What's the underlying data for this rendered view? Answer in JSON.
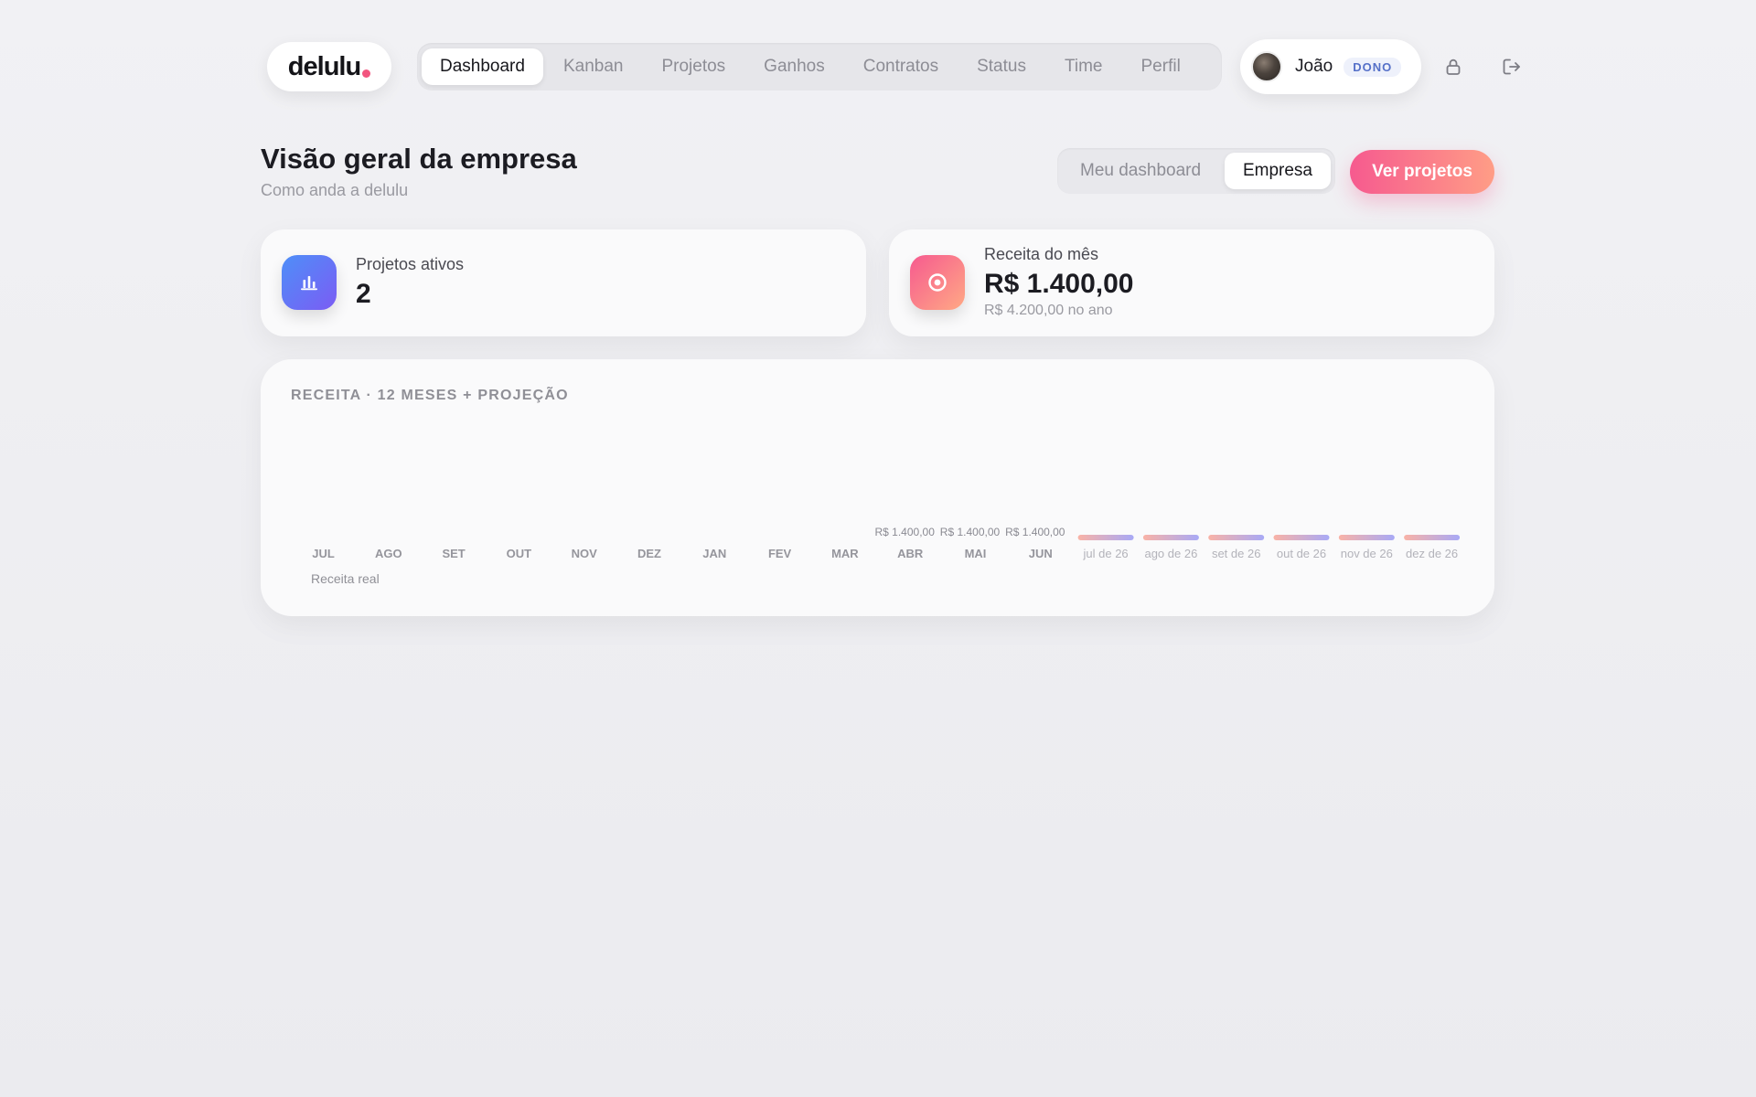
{
  "brand": {
    "name": "delulu",
    "dot_color": "#f2557f"
  },
  "nav": {
    "items": [
      {
        "label": "Dashboard",
        "active": true
      },
      {
        "label": "Kanban"
      },
      {
        "label": "Projetos"
      },
      {
        "label": "Ganhos"
      },
      {
        "label": "Contratos"
      },
      {
        "label": "Status"
      },
      {
        "label": "Time"
      },
      {
        "label": "Perfil"
      }
    ]
  },
  "user": {
    "name": "João",
    "role": "DONO"
  },
  "header_icons": {
    "lock": "lock-icon",
    "logout": "logout-icon"
  },
  "page": {
    "title": "Visão geral da empresa",
    "subtitle": "Como anda a delulu"
  },
  "view_toggle": {
    "options": [
      "Meu dashboard",
      "Empresa"
    ],
    "selected": "Empresa"
  },
  "actions": {
    "primary_label": "Ver projetos"
  },
  "stats": {
    "active_projects": {
      "label": "Projetos ativos",
      "value": "2",
      "icon": "bar-chart-icon"
    },
    "monthly_revenue": {
      "label": "Receita do mês",
      "value": "R$ 1.400,00",
      "note": "R$ 4.200,00 no ano",
      "icon": "coin-icon"
    }
  },
  "colors": {
    "accent_pink": "#f65a8f",
    "accent_peach": "#ffa985",
    "accent_blue": "#4e8ff8",
    "accent_violet": "#7b5cf4",
    "projection_bar_start": "#f9b2a6",
    "projection_bar_end": "#a8a9f6"
  },
  "chart_data": {
    "type": "bar",
    "title": "RECEITA · 12 MESES + PROJEÇÃO",
    "categories": [
      "JUL",
      "AGO",
      "SET",
      "OUT",
      "NOV",
      "DEZ",
      "JAN",
      "FEV",
      "MAR",
      "ABR",
      "MAI",
      "JUN",
      "jul de 26",
      "ago de 26",
      "set de 26",
      "out de 26",
      "nov de 26",
      "dez de 26"
    ],
    "series": [
      {
        "name": "Receita real",
        "values": [
          0,
          0,
          0,
          0,
          0,
          0,
          0,
          0,
          0,
          1400,
          1400,
          1400,
          null,
          null,
          null,
          null,
          null,
          null
        ],
        "labels": [
          "",
          "",
          "",
          "",
          "",
          "",
          "",
          "",
          "",
          "R$ 1.400,00",
          "R$ 1.400,00",
          "R$ 1.400,00",
          "",
          "",
          "",
          "",
          "",
          ""
        ]
      },
      {
        "values": [
          null,
          null,
          null,
          null,
          null,
          null,
          null,
          null,
          null,
          null,
          null,
          null,
          1400,
          1400,
          1400,
          1400,
          1400,
          1400
        ]
      }
    ],
    "ylim": [
      0,
      1400
    ],
    "grid": false,
    "legend": "bottom-left"
  }
}
